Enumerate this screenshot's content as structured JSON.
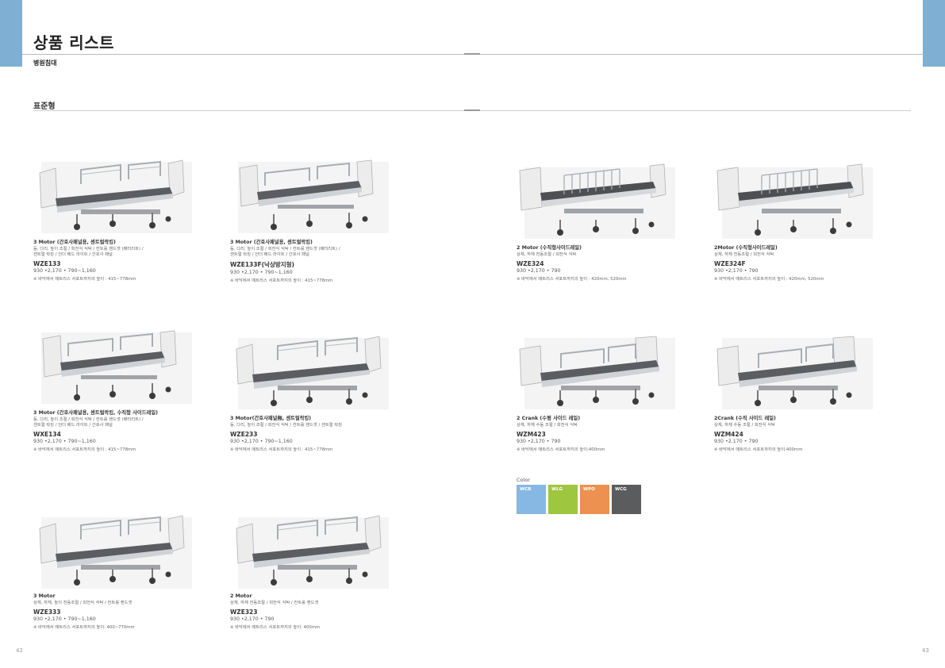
{
  "header": {
    "title": "상품 리스트",
    "category": "병원침대",
    "section": "표준형"
  },
  "products": [
    {
      "name": "3 Motor (간호사패널용, 센트럴락킹)",
      "features": "등, 다리, 높이 조절 / 회전식 식탁 / 컨트롤 핸드셋 (배터리트) /\n센트럴 락킹 / 언더 베드 라이트 / 간호사 패널",
      "model": "WZE133",
      "dimensions": "930 •2,170 • 790~1,160",
      "note": "※ 바닥에서 매트리스 서포트까지의 높이 : 415~778mm"
    },
    {
      "name": "3 Motor (간호사패널용, 센트럴락킹)",
      "features": "등, 다리, 높이 조절 / 회전식 식탁 / 컨트롤 핸드셋 (배터리트) /\n센트럴 락킹 / 언더 베드 라이트 / 간호사 패널",
      "model": "WZE133F(낙상방지형)",
      "dimensions": "930 •2,170 • 790~1,160",
      "note": "※ 바닥에서 매트리스 서포트까지의 높이 : 415~778mm"
    },
    {
      "name": "2 Motor (수직형사이드레일)",
      "features": "상체, 하체 전동조절 / 회전식 식탁",
      "model": "WZE324",
      "dimensions": "930 •2,170 • 790",
      "note": "※ 바닥에서 매트리스 서포트까지의 높이 : 420mm, 520mm"
    },
    {
      "name": "2Motor (수직형사이드레일)",
      "features": "상체, 하체 전동조절 / 회전식 식탁",
      "model": "WZE324F",
      "dimensions": "930 •2,170 • 790",
      "note": "※ 바닥에서 매트리스 서포트까지의 높이 : 420mm, 520mm"
    },
    {
      "name": "3 Motor (간호사패널용, 센트럴락킹, 수직형 사이드레일)",
      "features": "등, 다리, 높이 조절 / 회전식 식탁 / 컨트롤 핸드셋 (배터리트) /\n센트럴 락킹 / 언더 베드 라이트 / 간호사 패널",
      "model": "WXE134",
      "dimensions": "930 •2,170 • 790~1,160",
      "note": "※ 바닥에서 매트리스 서포트까지의 높이 : 415~778mm"
    },
    {
      "name": "3 Motor(간호사패널無, 센트럴락킹)",
      "features": "등, 다리, 높이 조절 / 회전식 식탁 / 컨트롤 핸드셋 / 센트럴 락킹",
      "model": "WZE233",
      "dimensions": "930 •2,170 • 790~1,160",
      "note": "※ 바닥에서 매트리스 서포트까지의 높이 : 415~778mm"
    },
    {
      "name": "2 Crank (수평 사이드 레일)",
      "features": "상체, 하체 수동 조절 / 회전식 식탁",
      "model": "WZM423",
      "dimensions": "930 •2,170 • 790",
      "note": "※ 바닥에서 매트리스 서포트까지의 높이:400mm"
    },
    {
      "name": "2Crank (수직 사이드 레일)",
      "features": "상체, 하체 수동 조절 / 회전식 식탁",
      "model": "WZM424",
      "dimensions": "930 •2,170 • 790",
      "note": "※ 바닥에서 매트리스 서포트까지의 높이:400mm"
    },
    {
      "name": "3 Motor",
      "features": "상체, 하체, 높이 전동조절 / 회전식 식탁 / 컨트롤 핸드셋",
      "model": "WZE333",
      "dimensions": "930 •2,170 • 790~1,160",
      "note": "※ 바닥에서 매트리스 서포트까지의 높이: 400~770mm"
    },
    {
      "name": "2 Motor",
      "features": "상체, 하체 전동조절 / 회전식 식탁 / 컨트롤 핸드셋",
      "model": "WZE323",
      "dimensions": "930 •2,170 • 790",
      "note": "※ 바닥에서 매트리스 서포트까지의 높이: 400mm"
    }
  ],
  "colors": {
    "label": "Color",
    "items": [
      {
        "code": "WCB",
        "hex": "#86b8e3"
      },
      {
        "code": "WLG",
        "hex": "#9fc63f"
      },
      {
        "code": "WPO",
        "hex": "#ec9150"
      },
      {
        "code": "WCG",
        "hex": "#5b5c5e"
      }
    ]
  },
  "pages": {
    "left": "42",
    "right": "43"
  }
}
